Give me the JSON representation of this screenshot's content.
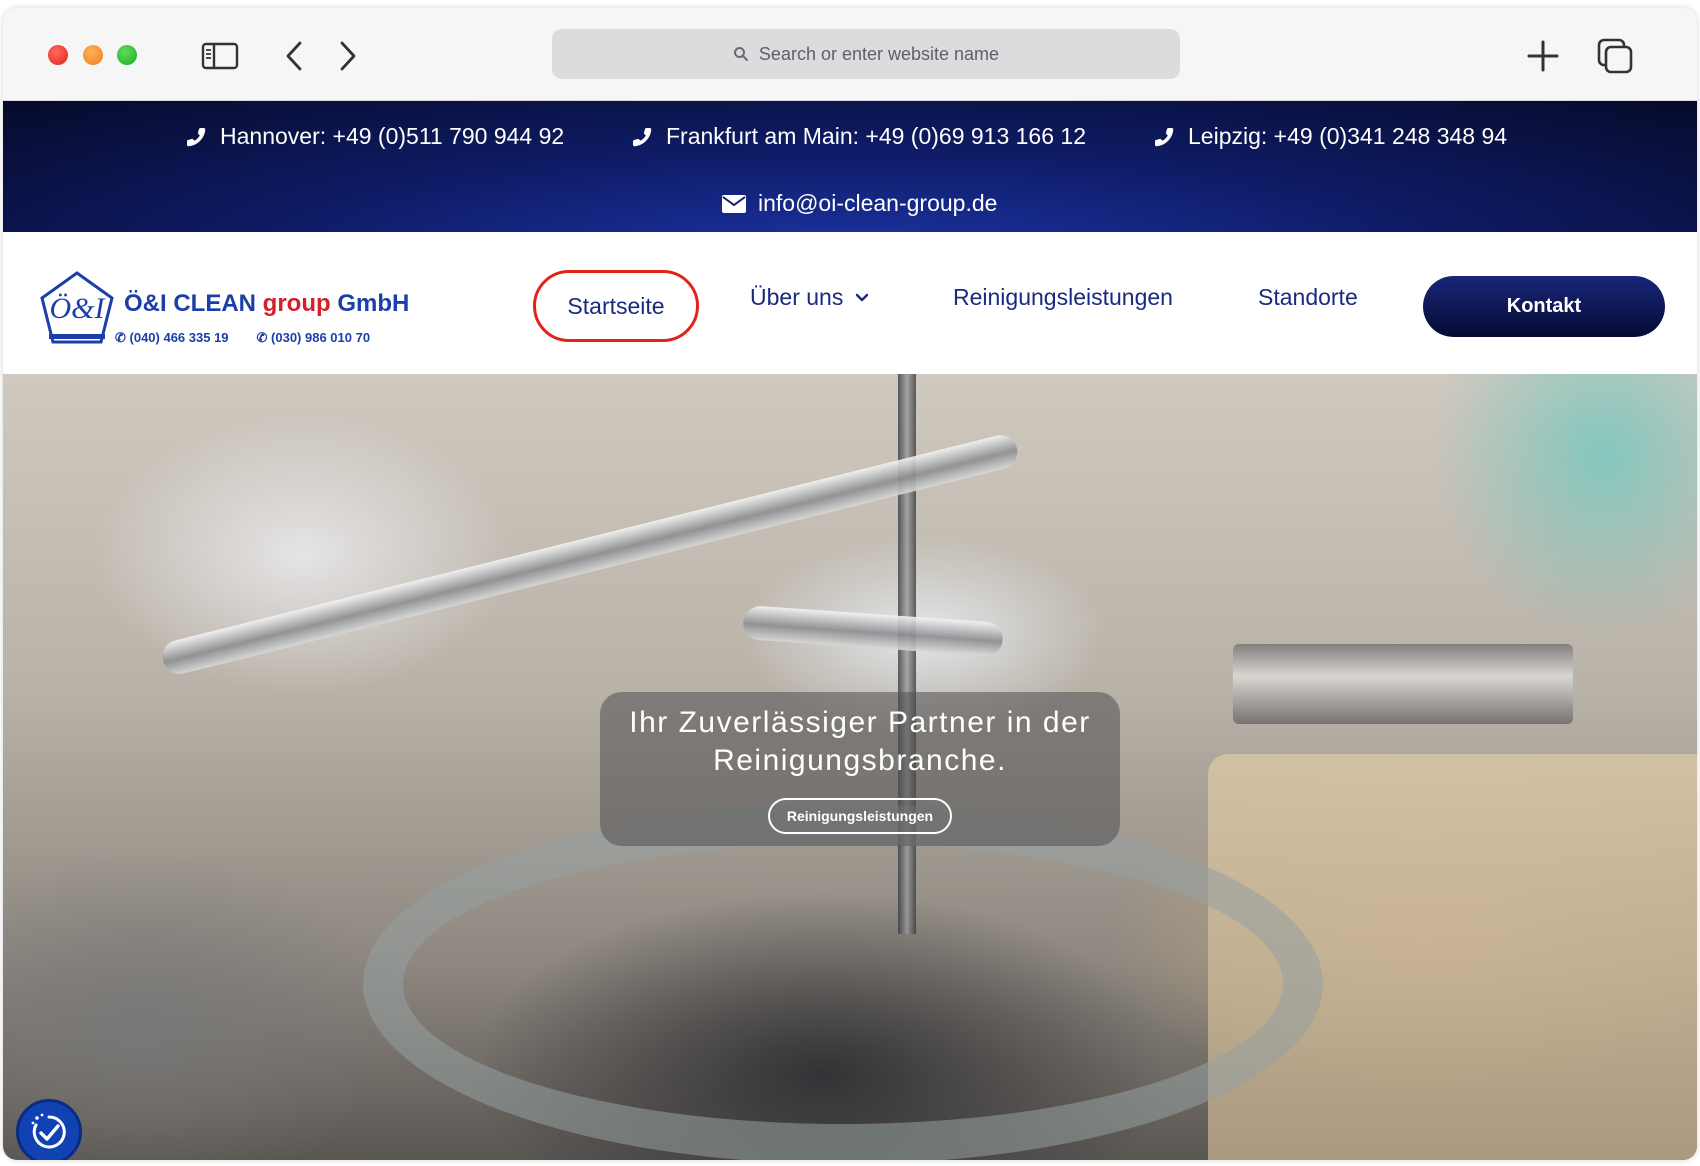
{
  "browser": {
    "address_placeholder": "Search or enter website name"
  },
  "topbar": {
    "phones": [
      {
        "label": "Hannover: +49 (0)511 790 944 92"
      },
      {
        "label": "Frankfurt am Main: +49 (0)69 913 166 12"
      },
      {
        "label": "Leipzig: +49 (0)341 248 348 94"
      }
    ],
    "email": "info@oi-clean-group.de"
  },
  "logo": {
    "mark": "Ö&I",
    "name_main": "Ö&I CLEAN",
    "name_group": "group",
    "name_suffix": "GmbH",
    "phone1": "✆ (040) 466 335 19",
    "phone2": "✆ (030) 986 010 70"
  },
  "nav": {
    "home": "Startseite",
    "about": "Über uns",
    "services": "Reinigungsleistungen",
    "locations": "Standorte",
    "contact": "Kontakt"
  },
  "hero": {
    "title_line1": "Ihr Zuverlässiger Partner in der",
    "title_line2": "Reinigungsbranche.",
    "button": "Reinigungsleistungen"
  },
  "colors": {
    "brand_navy": "#0f1d6a",
    "brand_blue": "#1b3ea8",
    "accent_red": "#e2231a"
  }
}
